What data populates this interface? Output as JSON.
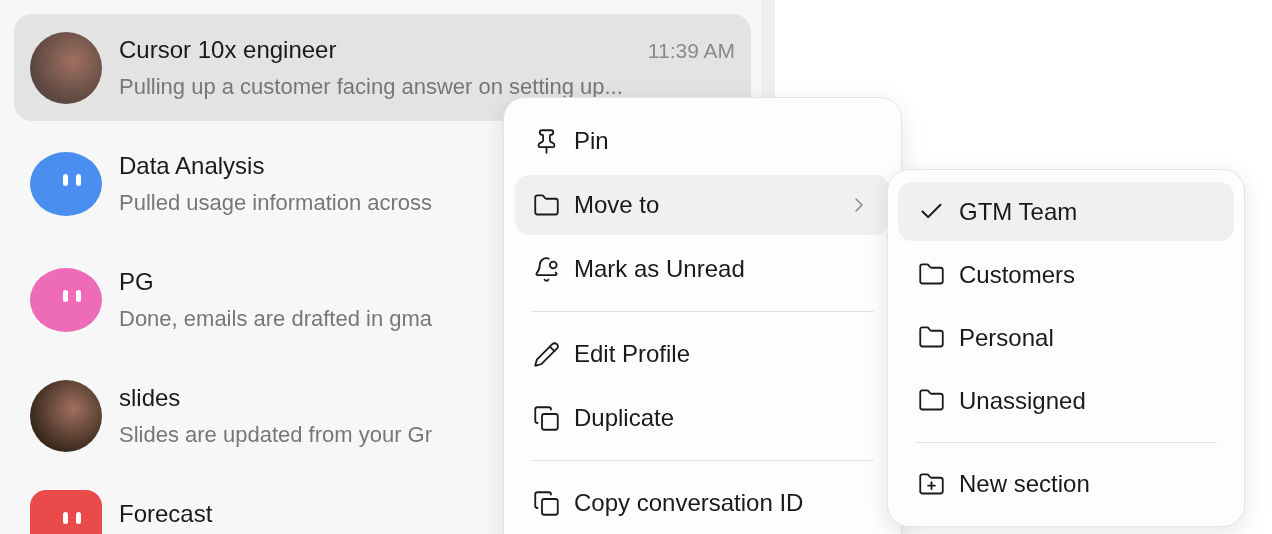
{
  "conversations": [
    {
      "title": "Cursor 10x engineer",
      "time": "11:39 AM",
      "preview": "Pulling up a customer facing answer on setting up...",
      "selected": true,
      "avatar": {
        "kind": "photo",
        "color": "#5a4640"
      }
    },
    {
      "title": "Data Analysis",
      "preview": "Pulled usage information across",
      "selected": false,
      "avatar": {
        "kind": "blob",
        "color": "#4a8ff0"
      }
    },
    {
      "title": "PG",
      "preview": "Done, emails are drafted in gma",
      "selected": false,
      "avatar": {
        "kind": "blob",
        "color": "#ee6bb7"
      }
    },
    {
      "title": "slides",
      "preview": "Slides are updated from your Gr",
      "selected": false,
      "avatar": {
        "kind": "photo",
        "color": "#3a2a1c"
      }
    },
    {
      "title": "Forecast",
      "selected": false,
      "avatar": {
        "kind": "tile",
        "color": "#e94b4b"
      }
    }
  ],
  "context_menu": {
    "groups": [
      [
        {
          "label": "Pin",
          "selected": false,
          "submenu": false
        },
        {
          "label": "Move to",
          "selected": true,
          "submenu": true
        },
        {
          "label": "Mark as Unread",
          "selected": false,
          "submenu": false
        }
      ],
      [
        {
          "label": "Edit Profile",
          "selected": false,
          "submenu": false
        },
        {
          "label": "Duplicate",
          "selected": false,
          "submenu": false
        }
      ],
      [
        {
          "label": "Copy conversation ID",
          "selected": false,
          "submenu": false
        }
      ]
    ]
  },
  "move_to_menu": {
    "sections": [
      {
        "label": "GTM Team",
        "selected": true
      },
      {
        "label": "Customers",
        "selected": false
      },
      {
        "label": "Personal",
        "selected": false
      },
      {
        "label": "Unassigned",
        "selected": false
      }
    ],
    "new_section": {
      "label": "New section"
    }
  }
}
